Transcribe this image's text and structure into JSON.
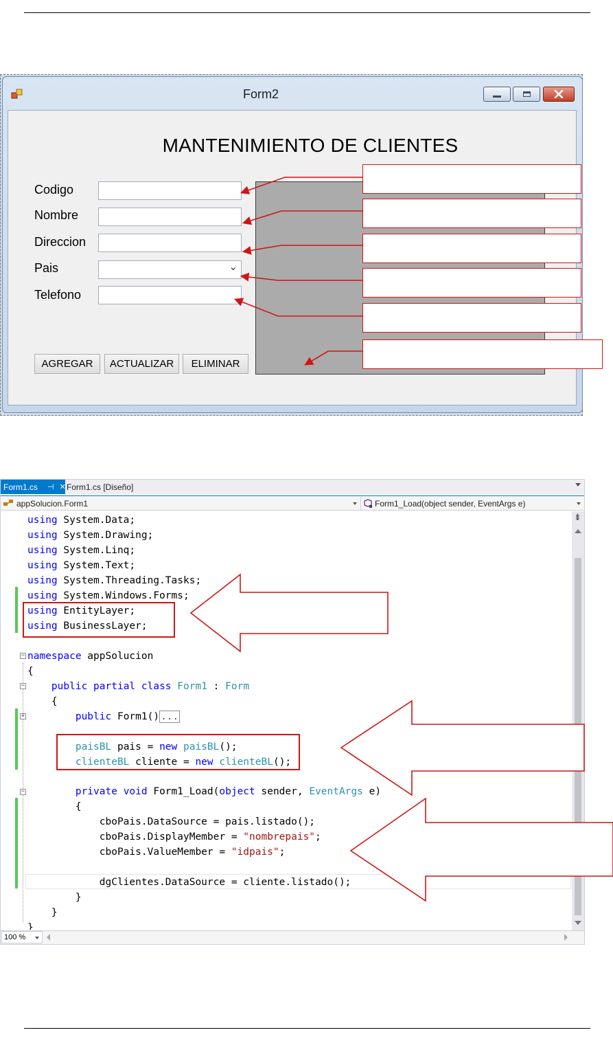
{
  "form_window": {
    "title": "Form2",
    "heading": "MANTENIMIENTO DE CLIENTES",
    "labels": [
      "Codigo",
      "Nombre",
      "Direccion",
      "Pais",
      "Telefono"
    ],
    "buttons": {
      "agregar": "AGREGAR",
      "actualizar": "ACTUALIZAR",
      "eliminar": "ELIMINAR"
    },
    "combo_arrow": "⌄"
  },
  "editor": {
    "tabs": [
      {
        "label": "Form1.cs",
        "pin": "⊣",
        "close": "✕",
        "active": true
      },
      {
        "label": "Form1.cs [Diseño]",
        "active": false
      }
    ],
    "nav_left": "appSolucion.Form1",
    "nav_right": "Form1_Load(object sender, EventArgs e)",
    "zoom": "100 %",
    "code": {
      "l1_kw": "using",
      "l1_rest": " System.Data;",
      "l2_kw": "using",
      "l2_rest": " System.Drawing;",
      "l3_kw": "using",
      "l3_rest": " System.Linq;",
      "l4_kw": "using",
      "l4_rest": " System.Text;",
      "l5_kw": "using",
      "l5_rest": " System.Threading.Tasks;",
      "l6_kw": "using",
      "l6_rest": " System.Windows.Forms;",
      "l7_kw": "using",
      "l7_rest": " EntityLayer;",
      "l8_kw": "using",
      "l8_rest": " BusinessLayer;",
      "l9_kw": "namespace",
      "l9_rest": " appSolucion",
      "l10": "{",
      "l11_a": "public",
      "l11_b": "partial",
      "l11_c": "class",
      "l11_d": "Form1",
      "l11_e": " : ",
      "l11_f": "Form",
      "l12": "{",
      "l13_kw": "public",
      "l13_rest": " Form1()",
      "l13_collapsed": "...",
      "l14_t1": "paisBL",
      "l14_r1": " pais = ",
      "l14_kw": "new",
      "l14_t2": "paisBL",
      "l14_r2": "();",
      "l15_t1": "clienteBL",
      "l15_r1": " cliente = ",
      "l15_kw": "new",
      "l15_t2": "clienteBL",
      "l15_r2": "();",
      "l16_a": "private",
      "l16_b": "void",
      "l16_c": " Form1_Load(",
      "l16_d": "object",
      "l16_e": " sender, ",
      "l16_f": "EventArgs",
      "l16_g": " e)",
      "l17": "{",
      "l18": "cboPais.DataSource = pais.listado();",
      "l19_a": "cboPais.DisplayMember = ",
      "l19_s": "\"nombrepais\"",
      "l19_e": ";",
      "l20_a": "cboPais.ValueMember = ",
      "l20_s": "\"idpais\"",
      "l20_e": ";",
      "l21": "dgClientes.DataSource = cliente.listado();",
      "l22": "}",
      "l23": "}",
      "l24": "}"
    }
  },
  "colors": {
    "keyword": "#0000ff",
    "type": "#2b91af",
    "string": "#a31515",
    "annotation_red": "#d01515",
    "vs_accent": "#007acc"
  }
}
